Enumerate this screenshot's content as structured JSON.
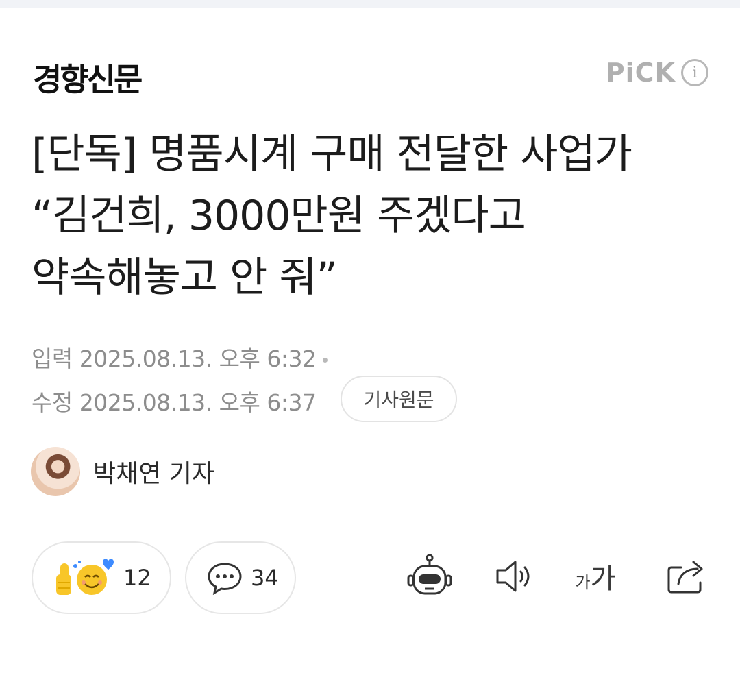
{
  "press": {
    "name": "경향신문",
    "pick_label": "PiCK",
    "info_icon": "info-icon"
  },
  "article": {
    "headline": "[단독] 명품시계 구매 전달한 사업가 “김건희, 3000만원 주겠다고 약속해놓고 안 줘”",
    "input_label": "입력",
    "input_time": "2025.08.13. 오후 6:32",
    "modified_label": "수정",
    "modified_time": "2025.08.13. 오후 6:37",
    "original_button": "기사원문"
  },
  "reporter": {
    "name": "박채연 기자"
  },
  "actions": {
    "reaction_count": "12",
    "comment_count": "34",
    "font_size_label_small": "가",
    "font_size_label_large": "가",
    "icons": [
      "reaction-emoji-icon",
      "comment-icon",
      "ai-bot-icon",
      "speaker-icon",
      "font-size-icon",
      "share-icon"
    ]
  },
  "colors": {
    "meta_gray": "#8d8d8d",
    "pick_gray": "#b0b0b0",
    "reaction_yellow": "#f8c629",
    "heart_blue": "#3d8bff"
  }
}
